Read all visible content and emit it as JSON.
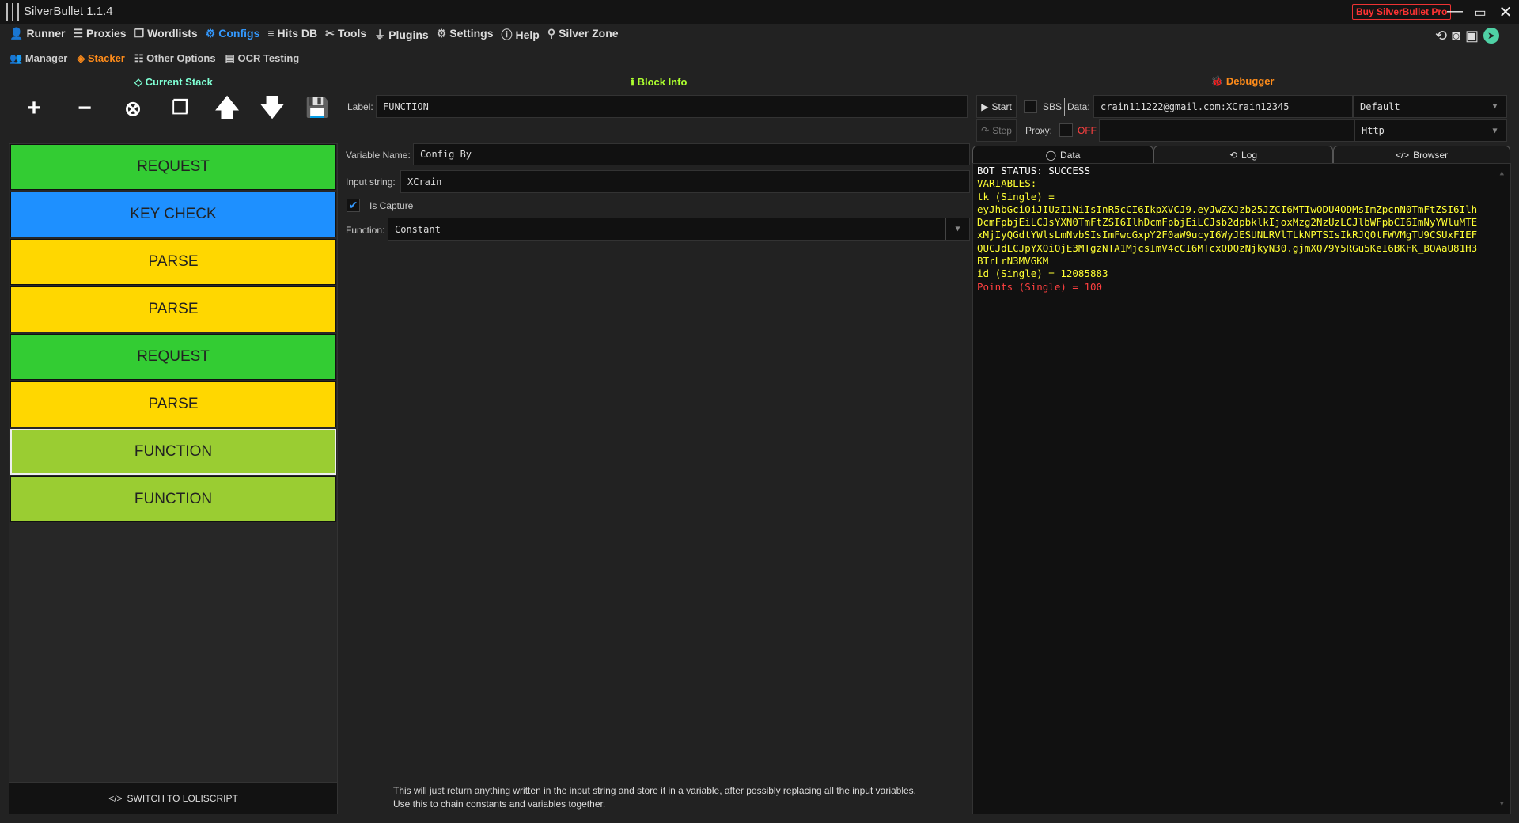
{
  "window": {
    "title": "SilverBullet 1.1.4",
    "buy_label": "Buy SilverBullet Pro"
  },
  "menu": [
    {
      "label": "Runner",
      "icon": "user-icon"
    },
    {
      "label": "Proxies",
      "icon": "server-icon"
    },
    {
      "label": "Wordlists",
      "icon": "files-icon"
    },
    {
      "label": "Configs",
      "icon": "gear-icon"
    },
    {
      "label": "Hits DB",
      "icon": "database-icon"
    },
    {
      "label": "Tools",
      "icon": "tools-icon"
    },
    {
      "label": "Plugins",
      "icon": "plug-icon"
    },
    {
      "label": "Settings",
      "icon": "settings-icon"
    },
    {
      "label": "Help",
      "icon": "help-icon"
    },
    {
      "label": "Silver Zone",
      "icon": "pin-icon"
    }
  ],
  "submenu": [
    {
      "label": "Manager"
    },
    {
      "label": "Stacker"
    },
    {
      "label": "Other Options"
    },
    {
      "label": "OCR Testing"
    }
  ],
  "sections": {
    "stack": "Current Stack",
    "block_info": "Block Info",
    "debugger": "Debugger"
  },
  "stack": {
    "blocks": [
      {
        "label": "REQUEST",
        "color": "#33cc33"
      },
      {
        "label": "KEY CHECK",
        "color": "#1e90ff"
      },
      {
        "label": "PARSE",
        "color": "#ffd700"
      },
      {
        "label": "PARSE",
        "color": "#ffd700"
      },
      {
        "label": "REQUEST",
        "color": "#33cc33"
      },
      {
        "label": "PARSE",
        "color": "#ffd700"
      },
      {
        "label": "FUNCTION",
        "color": "#9acd32"
      },
      {
        "label": "FUNCTION",
        "color": "#9acd32"
      }
    ],
    "switch_label": "SWITCH TO LOLISCRIPT"
  },
  "block": {
    "label_label": "Label:",
    "label_value": "FUNCTION",
    "var_label": "Variable Name:",
    "var_value": "Config By",
    "input_label": "Input string:",
    "input_value": "XCrain",
    "capture_label": "Is Capture",
    "function_label": "Function:",
    "function_value": "Constant",
    "description": [
      "This will just return anything written in the input string and store it in a variable, after possibly replacing all the input variables.",
      "Use this to chain constants and variables together."
    ]
  },
  "debugger": {
    "start": "Start",
    "sbs": "SBS",
    "data_label": "Data:",
    "data_value": "crain111222@gmail.com:XCrain12345",
    "wordlist_type": "Default",
    "step": "Step",
    "proxy_label": "Proxy:",
    "proxy_state": "OFF",
    "proxy_type": "Http",
    "tabs": [
      "Data",
      "Log",
      "Browser"
    ],
    "output": {
      "status": "BOT STATUS: SUCCESS",
      "variables": "VARIABLES:",
      "tk_line": "tk (Single) =",
      "tk_value": "eyJhbGciOiJIUzI1NiIsInR5cCI6IkpXVCJ9.eyJwZXJzb25JZCI6MTIwODU4ODMsImZpcnN0TmFtZSI6IlhDcmFpbjEiLCJsYXN0TmFtZSI6IlhDcmFpbjEiLCJsb2dpbklkIjoxMzg2NzUzLCJlbWFpbCI6ImNyYWluMTExMjIyQGdtYWlsLmNvbSIsImFwcGxpY2F0aW9ucyI6WyJESUNLRVlTLkNPTSIsIkRJQ0tFWVMgTU9CSUxFIEFQUCJdLCJpYXQiOjE3MTgzNTA1MjcsImV4cCI6MTcxODQzNjkyN30.gjmXQ79Y5RGu5KeI6BKFK_BQAaU81H3BTrLrN3MVGKM",
      "id_line": "id (Single) = 12085883",
      "points_line": "Points (Single) = 100"
    }
  }
}
